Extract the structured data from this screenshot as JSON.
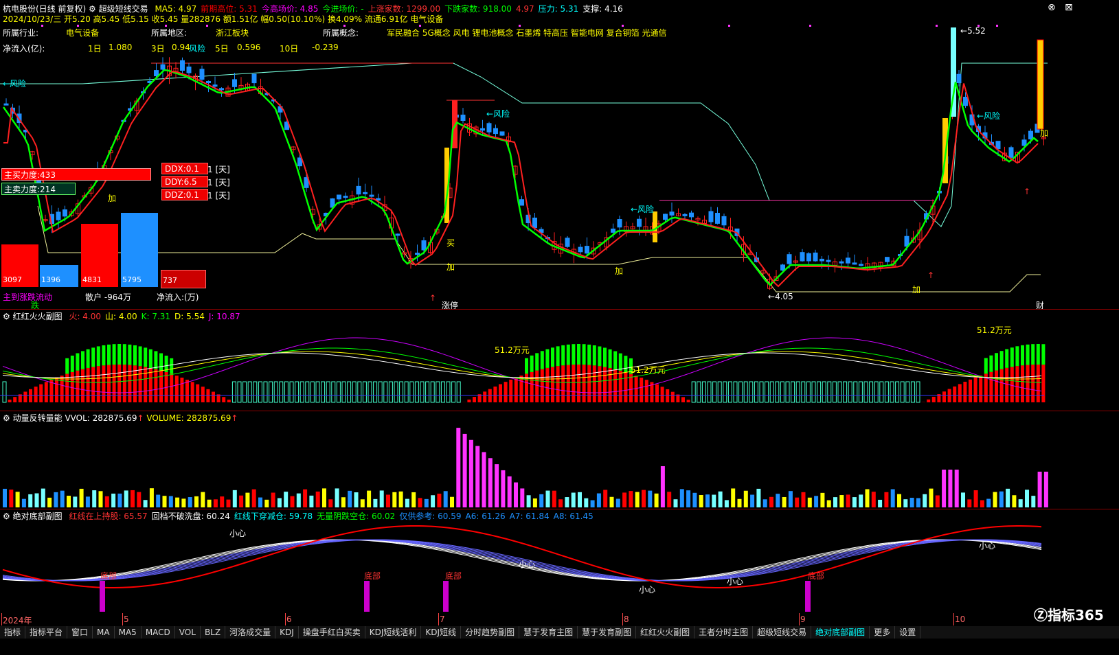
{
  "header": {
    "stock_name": "杭电股份(日线 前复权)",
    "indicator_name": "超级短线交易",
    "items": [
      {
        "label": "MA5: 4.97",
        "color": "#ffff00"
      },
      {
        "label": "前期高位: 5.31",
        "color": "#ff0000"
      },
      {
        "label": "今高场价: 4.85",
        "color": "#ff00ff"
      },
      {
        "label": "今进场价: -",
        "color": "#00ff00"
      },
      {
        "label": "上涨家数: 1299.00",
        "color": "#ff3333"
      },
      {
        "label": "下跌家数: 918.00",
        "color": "#00ff00"
      },
      {
        "label": "4.97",
        "color": "#ff3333"
      },
      {
        "label": "压力: 5.31",
        "color": "#00ffff"
      },
      {
        "label": "支撑: 4.16",
        "color": "#ffffff"
      }
    ],
    "row2": "2024/10/23/三 开5.20 高5.45 低5.15 收5.45 量282876 额1.51亿 幅0.50(10.10%) 换4.09% 流通6.91亿 电气设备",
    "industry_label": "所属行业:",
    "industry_value": "电气设备",
    "region_label": "所属地区:",
    "region_value": "浙江板块",
    "concept_label": "所属概念:",
    "concept_value": "军民融合 5G概念 风电 锂电池概念 石墨烯 特高压 智能电网 复合铜箔 光通信",
    "netflow_label": "净流入(亿):",
    "netflow": [
      {
        "period": "1日",
        "value": "1.080"
      },
      {
        "period": "3日",
        "value": "0.94"
      },
      {
        "period": "5日",
        "value": "0.596"
      },
      {
        "period": "10日",
        "value": "-0.239"
      }
    ]
  },
  "main_chart": {
    "annotations": {
      "risk": "←风险",
      "add": "加",
      "buy": "买",
      "price_high": "5.52",
      "price_low": "4.05",
      "limit_up": "涨停",
      "finance": "财",
      "drop": "跌",
      "risk2": "风险"
    },
    "force_boxes": [
      {
        "label": "主买力度:433",
        "bg": "#ff0000"
      },
      {
        "label": "主卖力度:214",
        "bg": "#003300"
      }
    ],
    "ddx": [
      {
        "label": "DDX:0.1",
        "suffix": "1 [天]"
      },
      {
        "label": "DDY:6.5",
        "suffix": "1 [天]"
      },
      {
        "label": "DDZ:0.1",
        "suffix": "1 [天]"
      }
    ],
    "flow_bars": [
      {
        "value": "3097",
        "color": "#ff0000"
      },
      {
        "value": "1396",
        "color": "#1e90ff"
      },
      {
        "value": "4831",
        "color": "#ff0000"
      },
      {
        "value": "5795",
        "color": "#1e90ff"
      },
      {
        "value": "737",
        "color": "#cc0000"
      }
    ],
    "flow_labels": {
      "big": "主到涨跌流动",
      "retail": "散户 -964万",
      "net": "净流入:(万)"
    }
  },
  "panel2": {
    "title": "红红火火副图",
    "items": [
      {
        "label": "火: 4.00",
        "color": "#ff3333"
      },
      {
        "label": "山: 4.00",
        "color": "#ffff00"
      },
      {
        "label": "K: 7.31",
        "color": "#00ff00"
      },
      {
        "label": "D: 5.54",
        "color": "#ffff00"
      },
      {
        "label": "J: 10.87",
        "color": "#ff00ff"
      }
    ],
    "annotation": "51.2万元"
  },
  "panel3": {
    "title": "动量反转量能",
    "vvol": "VVOL: 282875.69",
    "volume": "VOLUME: 282875.69"
  },
  "panel4": {
    "title": "绝对底部副图",
    "items": [
      {
        "label": "红线在上持股: 65.57",
        "color": "#ff3333"
      },
      {
        "label": "回档不破洗盘: 60.24",
        "color": "#ffffff"
      },
      {
        "label": "红线下穿减仓: 59.78",
        "color": "#00ffff"
      },
      {
        "label": "无量阴跌空仓: 60.02",
        "color": "#00ff00"
      },
      {
        "label": "仅供参考: 60.59",
        "color": "#1e90ff"
      },
      {
        "label": "A6: 61.26",
        "color": "#1e90ff"
      },
      {
        "label": "A7: 61.84",
        "color": "#1e90ff"
      },
      {
        "label": "A8: 61.45",
        "color": "#1e90ff"
      }
    ],
    "bottom_label": "底部",
    "careful_label": "小心"
  },
  "x_axis": {
    "labels": [
      "2024年",
      "5",
      "6",
      "7",
      "8",
      "9",
      "10"
    ]
  },
  "bottom_tabs": [
    "指标",
    "指标平台",
    "窗口",
    "MA",
    "MA5",
    "MACD",
    "VOL",
    "BLZ",
    "河洛成交量",
    "KDJ",
    "操盘手红白买卖",
    "KDJ短线活利",
    "KDJ短线",
    "分时趋势副图",
    "慧于发育主图",
    "慧于发育副图",
    "红红火火副图",
    "王者分时主图",
    "超级短线交易",
    "绝对底部副图",
    "更多",
    "设置"
  ],
  "active_tab": "绝对底部副图",
  "brand": "指标365",
  "colors": {
    "up": "#ff0000",
    "down": "#1e90ff",
    "ma_green": "#00ff00",
    "ma_yellow": "#ffcc00",
    "ma_red": "#ff2020"
  }
}
